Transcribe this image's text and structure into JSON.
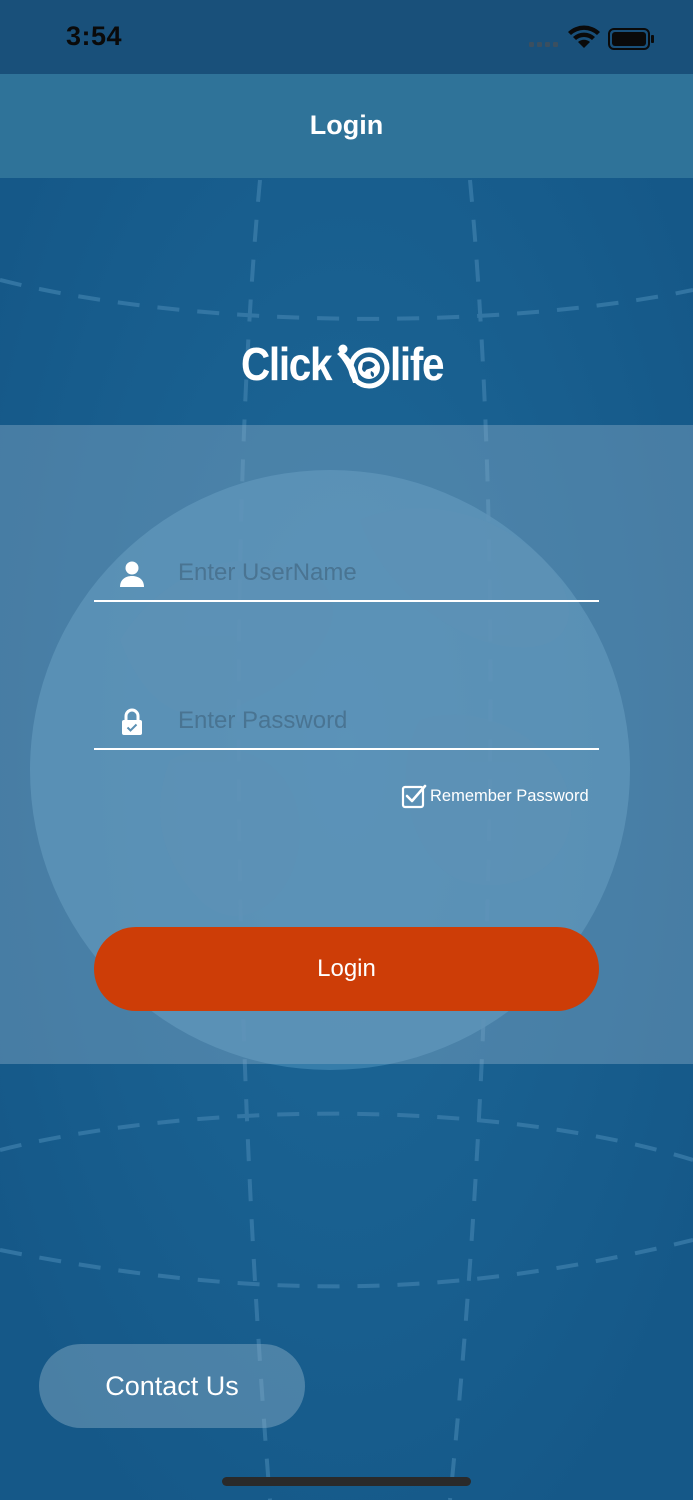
{
  "status_bar": {
    "time": "3:54",
    "icons": [
      "signal-icon",
      "wifi-icon",
      "battery-icon"
    ]
  },
  "nav": {
    "title": "Login"
  },
  "logo": {
    "word_left": "Click",
    "word_right": "life",
    "mark_icon": "globe-figure-icon"
  },
  "form": {
    "username": {
      "placeholder": "Enter UserName",
      "value": "",
      "icon": "user-icon"
    },
    "password": {
      "placeholder": "Enter Password",
      "value": "",
      "icon": "lock-icon"
    },
    "remember": {
      "label": "Remember Password",
      "checked": true
    },
    "login_label": "Login"
  },
  "contact_label": "Contact Us",
  "colors": {
    "background": "#17598a",
    "nav_bar": "#2f7399",
    "status_bar": "#19507a",
    "login_button": "#cd3d07",
    "panel": "#8cafc8"
  }
}
